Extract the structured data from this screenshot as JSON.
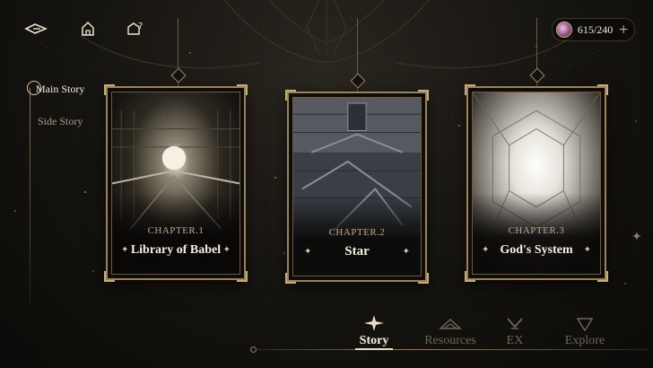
{
  "currency": {
    "value": "615/240",
    "plus": "+",
    "icon": "stamina-orb-icon"
  },
  "top_buttons": [
    {
      "name": "back",
      "icon": "back-arrow-icon"
    },
    {
      "name": "home",
      "icon": "home-icon"
    },
    {
      "name": "help",
      "icon": "help-question-icon"
    }
  ],
  "left_nav": {
    "main_story": "Main Story",
    "side_story": "Side Story"
  },
  "chapters": [
    {
      "chapter": "CHAPTER.1",
      "title": "Library of Babel"
    },
    {
      "chapter": "CHAPTER.2",
      "title": "Star"
    },
    {
      "chapter": "CHAPTER.3",
      "title": "God's System"
    }
  ],
  "tabs": {
    "story": "Story",
    "resources": "Resources",
    "ex": "EX",
    "explore": "Explore",
    "active": "story"
  },
  "sparkle": "✦",
  "colors": {
    "gold": "#c7ac76",
    "text_active": "#f6efe0",
    "text_inactive": "#6f6656"
  }
}
